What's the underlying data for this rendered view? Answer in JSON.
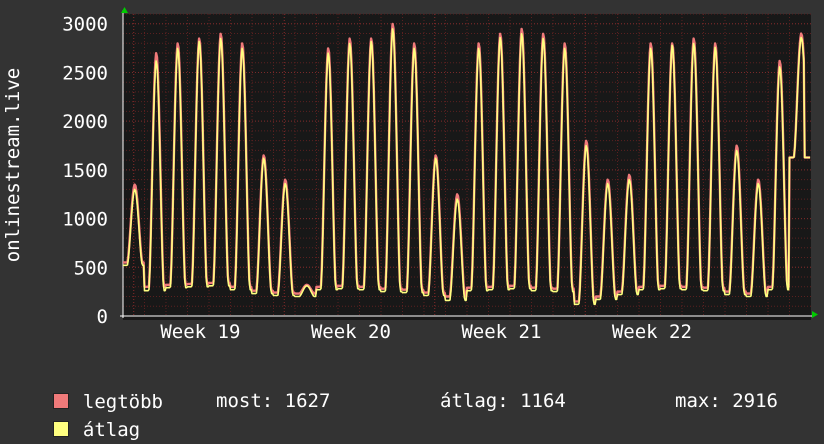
{
  "chart_data": {
    "type": "line",
    "ylabel": "onlinestream.live",
    "ylim": [
      0,
      3100
    ],
    "yticks": [
      0,
      500,
      1000,
      1500,
      2000,
      2500,
      3000
    ],
    "xticks": [
      "Week 19",
      "Week 20",
      "Week 21",
      "Week 22"
    ],
    "grid": true,
    "legend_placement": "bottom",
    "series": [
      {
        "name": "legtöbb",
        "color": "#f07a7a",
        "daily_peaks": [
          1350,
          2700,
          2800,
          2850,
          2900,
          2800,
          1650,
          1400,
          320,
          2750,
          2850,
          2850,
          3000,
          2800,
          1650,
          1250,
          2800,
          2900,
          2950,
          2900,
          2800,
          1800,
          1400,
          1450,
          2800,
          2800,
          2850,
          2800,
          1750,
          1400,
          2620,
          2900
        ],
        "daily_lows": [
          550,
          300,
          320,
          330,
          340,
          300,
          260,
          240,
          230,
          300,
          310,
          300,
          280,
          270,
          240,
          200,
          290,
          300,
          310,
          290,
          280,
          150,
          200,
          250,
          300,
          310,
          300,
          290,
          250,
          230,
          300,
          1627
        ]
      },
      {
        "name": "átlag",
        "color": "#ffff80",
        "daily_peaks": [
          1300,
          2620,
          2750,
          2820,
          2850,
          2750,
          1620,
          1360,
          310,
          2700,
          2800,
          2820,
          2950,
          2750,
          1620,
          1200,
          2750,
          2860,
          2900,
          2850,
          2750,
          1750,
          1360,
          1400,
          2750,
          2780,
          2800,
          2760,
          1700,
          1360,
          2560,
          2860
        ],
        "daily_lows": [
          520,
          260,
          290,
          300,
          310,
          270,
          230,
          210,
          200,
          270,
          280,
          270,
          250,
          240,
          210,
          160,
          260,
          270,
          280,
          260,
          250,
          120,
          170,
          220,
          270,
          280,
          270,
          260,
          220,
          200,
          270,
          1627
        ]
      }
    ]
  },
  "legend": [
    {
      "label": "legtöbb",
      "color": "#f07a7a"
    },
    {
      "label": "átlag",
      "color": "#ffff80"
    }
  ],
  "stats": {
    "most": "most: 1627",
    "atlag": "átlag: 1164",
    "max": "max: 2916"
  },
  "colors": {
    "background": "#333333",
    "plot": "#181818",
    "grid": "#5a2020",
    "arrow": "#00cc00"
  }
}
